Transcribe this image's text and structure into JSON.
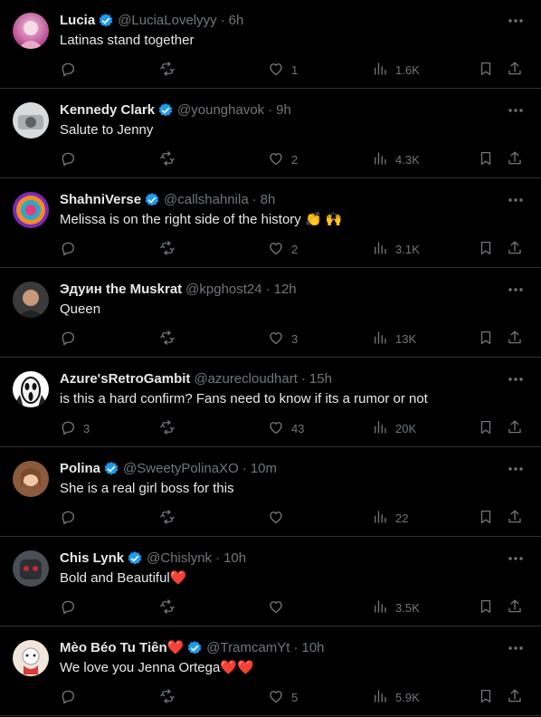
{
  "colors": {
    "background": "#000000",
    "verified": "#1d9bf0",
    "heart": "#f91880",
    "muted": "#71767b",
    "text": "#e7e9ea"
  },
  "icons": {
    "reply": "reply-icon",
    "retweet": "retweet-icon",
    "like": "heart-icon",
    "views": "views-icon",
    "bookmark": "bookmark-icon",
    "share": "share-icon",
    "more": "more-icon",
    "verified": "verified-badge-icon"
  },
  "tweets": [
    {
      "name": "Lucia",
      "verified": true,
      "handle": "@LuciaLovelyyy",
      "time": "6h",
      "text": "Latinas stand together",
      "replies": "",
      "retweets": "",
      "likes": "1",
      "views": "1.6K"
    },
    {
      "name": "Kennedy Clark",
      "verified": true,
      "handle": "@younghavok",
      "time": "9h",
      "text": "Salute to Jenny",
      "replies": "",
      "retweets": "",
      "likes": "2",
      "views": "4.3K"
    },
    {
      "name": "ShahniVerse",
      "verified": true,
      "handle": "@callshahnila",
      "time": "8h",
      "text": "Melissa is on the right side of the history 👏 🙌",
      "replies": "",
      "retweets": "",
      "likes": "2",
      "views": "3.1K"
    },
    {
      "name": "Эдуин the Muskrat",
      "verified": false,
      "handle": "@kpghost24",
      "time": "12h",
      "text": "Queen",
      "replies": "",
      "retweets": "",
      "likes": "3",
      "views": "13K"
    },
    {
      "name": "Azure'sRetroGambit",
      "verified": false,
      "handle": "@azurecloudhart",
      "time": "15h",
      "text": "is this a hard confirm? Fans need to know if its a rumor or not",
      "replies": "3",
      "retweets": "",
      "likes": "43",
      "views": "20K"
    },
    {
      "name": "Polina",
      "verified": true,
      "handle": "@SweetyPolinaXO",
      "time": "10m",
      "text": "She is a real girl boss for this",
      "replies": "",
      "retweets": "",
      "likes": "",
      "views": "22"
    },
    {
      "name": "Chis Lynk",
      "verified": true,
      "handle": "@Chislynk",
      "time": "10h",
      "text": "Bold and Beautiful❤️",
      "replies": "",
      "retweets": "",
      "likes": "",
      "views": "3.5K"
    },
    {
      "name": "Mèo Béo Tu Tiên❤️",
      "verified": true,
      "handle": "@TramcamYt",
      "time": "10h",
      "text": "We love you Jenna Ortega❤️❤️",
      "replies": "",
      "retweets": "",
      "likes": "5",
      "views": "5.9K"
    }
  ]
}
